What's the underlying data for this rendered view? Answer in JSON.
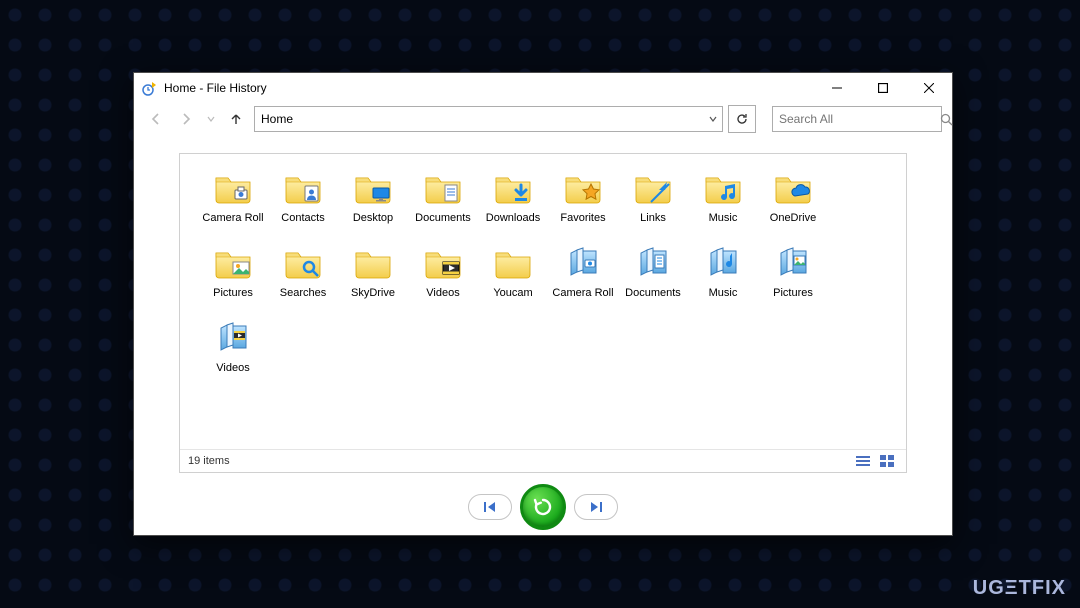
{
  "window_title": "Home - File History",
  "address_bar": {
    "value": "Home"
  },
  "search": {
    "placeholder": "Search All"
  },
  "status": {
    "count_text": "19 items"
  },
  "watermark": "UGΞTFIX",
  "items": [
    {
      "label": "Camera Roll",
      "icon": "folder-camera"
    },
    {
      "label": "Contacts",
      "icon": "folder-contacts"
    },
    {
      "label": "Desktop",
      "icon": "folder-desktop"
    },
    {
      "label": "Documents",
      "icon": "folder-documents"
    },
    {
      "label": "Downloads",
      "icon": "folder-downloads"
    },
    {
      "label": "Favorites",
      "icon": "folder-favorites"
    },
    {
      "label": "Links",
      "icon": "folder-links"
    },
    {
      "label": "Music",
      "icon": "folder-music"
    },
    {
      "label": "OneDrive",
      "icon": "folder-onedrive"
    },
    {
      "label": "Pictures",
      "icon": "folder-pictures"
    },
    {
      "label": "Searches",
      "icon": "folder-searches"
    },
    {
      "label": "SkyDrive",
      "icon": "folder-generic"
    },
    {
      "label": "Videos",
      "icon": "folder-videos"
    },
    {
      "label": "Youcam",
      "icon": "folder-generic"
    },
    {
      "label": "Camera Roll",
      "icon": "library-camera"
    },
    {
      "label": "Documents",
      "icon": "library-documents"
    },
    {
      "label": "Music",
      "icon": "library-music"
    },
    {
      "label": "Pictures",
      "icon": "library-pictures"
    },
    {
      "label": "Videos",
      "icon": "library-videos"
    }
  ]
}
